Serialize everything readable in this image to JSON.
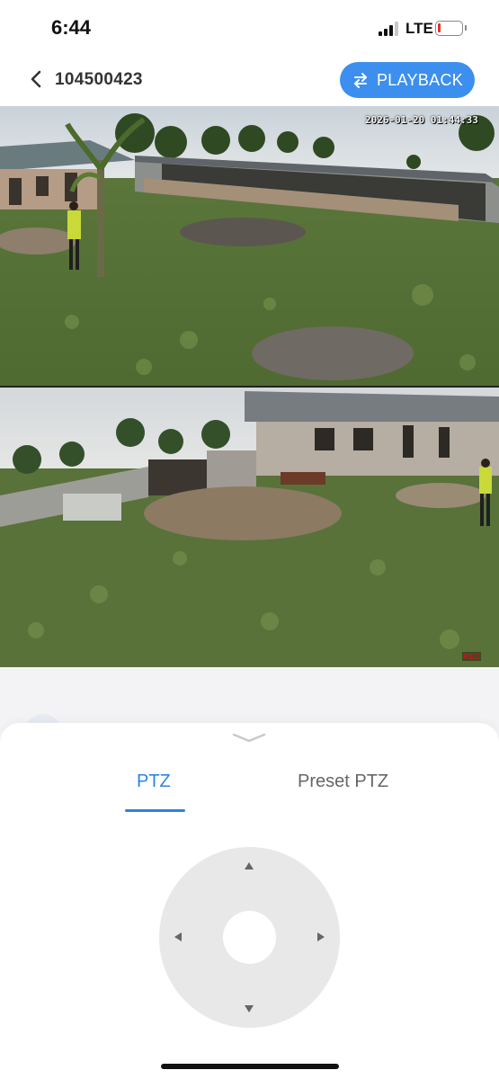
{
  "status_bar": {
    "time": "6:44",
    "network": "LTE",
    "battery_level": 0.1,
    "battery_color": "#e5322b",
    "signal_bars": 3
  },
  "header": {
    "back_icon": "chevron-left-icon",
    "device_id": "104500423",
    "playback_label": "PLAYBACK",
    "playback_icon": "swap-arrows-icon",
    "accent_color": "#3c8fee"
  },
  "feeds": {
    "top": {
      "timestamp": "2026-01-20 01:44:33"
    },
    "bottom": {
      "rec_badge": "REC"
    }
  },
  "ptz_panel": {
    "collapse_icon": "chevron-down-icon",
    "tabs": [
      {
        "label": "PTZ",
        "active": true
      },
      {
        "label": "Preset PTZ",
        "active": false
      }
    ],
    "active_color": "#2d83e0",
    "controls": [
      "arrow-up-icon",
      "arrow-down-icon",
      "arrow-left-icon",
      "arrow-right-icon"
    ]
  }
}
